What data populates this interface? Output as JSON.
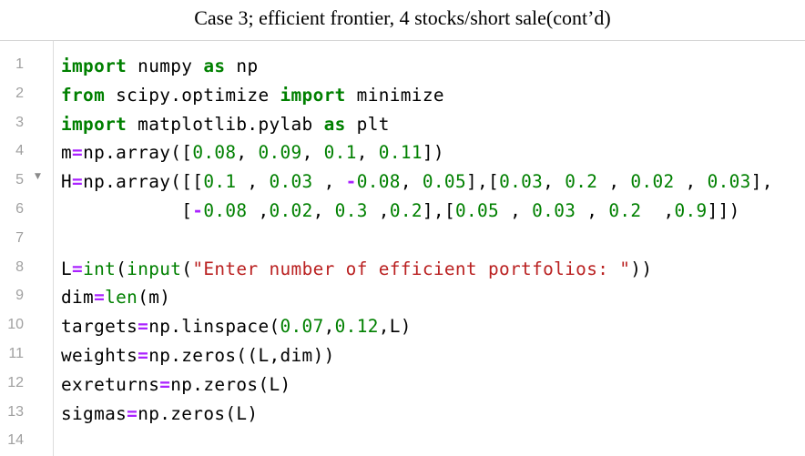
{
  "title": "Case 3; efficient frontier, 4 stocks/short sale(cont’d)",
  "editor": {
    "lines": [
      {
        "number": "1",
        "fold": "",
        "tokens": [
          {
            "t": "import",
            "c": "kw"
          },
          {
            "t": " numpy ",
            "c": "id"
          },
          {
            "t": "as",
            "c": "kw"
          },
          {
            "t": " np",
            "c": "id"
          }
        ]
      },
      {
        "number": "2",
        "fold": "",
        "tokens": [
          {
            "t": "from",
            "c": "kw"
          },
          {
            "t": " scipy.optimize ",
            "c": "id"
          },
          {
            "t": "import",
            "c": "kw"
          },
          {
            "t": " minimize",
            "c": "id"
          }
        ]
      },
      {
        "number": "3",
        "fold": "",
        "tokens": [
          {
            "t": "import",
            "c": "kw"
          },
          {
            "t": " matplotlib.pylab ",
            "c": "id"
          },
          {
            "t": "as",
            "c": "kw"
          },
          {
            "t": " plt",
            "c": "id"
          }
        ]
      },
      {
        "number": "4",
        "fold": "",
        "tokens": [
          {
            "t": "m",
            "c": "id"
          },
          {
            "t": "=",
            "c": "op"
          },
          {
            "t": "np.array([",
            "c": "id"
          },
          {
            "t": "0.08",
            "c": "num"
          },
          {
            "t": ", ",
            "c": "pu"
          },
          {
            "t": "0.09",
            "c": "num"
          },
          {
            "t": ", ",
            "c": "pu"
          },
          {
            "t": "0.1",
            "c": "num"
          },
          {
            "t": ", ",
            "c": "pu"
          },
          {
            "t": "0.11",
            "c": "num"
          },
          {
            "t": "])",
            "c": "pu"
          }
        ]
      },
      {
        "number": "5",
        "fold": "▼",
        "tokens": [
          {
            "t": "H",
            "c": "id"
          },
          {
            "t": "=",
            "c": "op"
          },
          {
            "t": "np.array([[",
            "c": "id"
          },
          {
            "t": "0.1",
            "c": "num"
          },
          {
            "t": " , ",
            "c": "pu"
          },
          {
            "t": "0.03",
            "c": "num"
          },
          {
            "t": " , ",
            "c": "pu"
          },
          {
            "t": "-",
            "c": "op"
          },
          {
            "t": "0.08",
            "c": "num"
          },
          {
            "t": ", ",
            "c": "pu"
          },
          {
            "t": "0.05",
            "c": "num"
          },
          {
            "t": "],[",
            "c": "pu"
          },
          {
            "t": "0.03",
            "c": "num"
          },
          {
            "t": ", ",
            "c": "pu"
          },
          {
            "t": "0.2",
            "c": "num"
          },
          {
            "t": " , ",
            "c": "pu"
          },
          {
            "t": "0.02",
            "c": "num"
          },
          {
            "t": " , ",
            "c": "pu"
          },
          {
            "t": "0.03",
            "c": "num"
          },
          {
            "t": "],",
            "c": "pu"
          }
        ]
      },
      {
        "number": "6",
        "fold": "",
        "tokens": [
          {
            "t": "           [",
            "c": "pu"
          },
          {
            "t": "-",
            "c": "op"
          },
          {
            "t": "0.08",
            "c": "num"
          },
          {
            "t": " ,",
            "c": "pu"
          },
          {
            "t": "0.02",
            "c": "num"
          },
          {
            "t": ", ",
            "c": "pu"
          },
          {
            "t": "0.3",
            "c": "num"
          },
          {
            "t": " ,",
            "c": "pu"
          },
          {
            "t": "0.2",
            "c": "num"
          },
          {
            "t": "],[",
            "c": "pu"
          },
          {
            "t": "0.05",
            "c": "num"
          },
          {
            "t": " , ",
            "c": "pu"
          },
          {
            "t": "0.03",
            "c": "num"
          },
          {
            "t": " , ",
            "c": "pu"
          },
          {
            "t": "0.2",
            "c": "num"
          },
          {
            "t": "  ,",
            "c": "pu"
          },
          {
            "t": "0.9",
            "c": "num"
          },
          {
            "t": "]])",
            "c": "pu"
          }
        ]
      },
      {
        "number": "7",
        "fold": "",
        "tokens": []
      },
      {
        "number": "8",
        "fold": "",
        "tokens": [
          {
            "t": "L",
            "c": "id"
          },
          {
            "t": "=",
            "c": "op"
          },
          {
            "t": "int",
            "c": "bi"
          },
          {
            "t": "(",
            "c": "pu"
          },
          {
            "t": "input",
            "c": "bi"
          },
          {
            "t": "(",
            "c": "pu"
          },
          {
            "t": "\"Enter number of efficient portfolios: \"",
            "c": "str"
          },
          {
            "t": "))",
            "c": "pu"
          }
        ]
      },
      {
        "number": "9",
        "fold": "",
        "tokens": [
          {
            "t": "dim",
            "c": "id"
          },
          {
            "t": "=",
            "c": "op"
          },
          {
            "t": "len",
            "c": "bi"
          },
          {
            "t": "(m)",
            "c": "pu"
          }
        ]
      },
      {
        "number": "10",
        "fold": "",
        "tokens": [
          {
            "t": "targets",
            "c": "id"
          },
          {
            "t": "=",
            "c": "op"
          },
          {
            "t": "np.linspace(",
            "c": "id"
          },
          {
            "t": "0.07",
            "c": "num"
          },
          {
            "t": ",",
            "c": "pu"
          },
          {
            "t": "0.12",
            "c": "num"
          },
          {
            "t": ",L)",
            "c": "pu"
          }
        ]
      },
      {
        "number": "11",
        "fold": "",
        "tokens": [
          {
            "t": "weights",
            "c": "id"
          },
          {
            "t": "=",
            "c": "op"
          },
          {
            "t": "np.zeros((L,dim))",
            "c": "id"
          }
        ]
      },
      {
        "number": "12",
        "fold": "",
        "tokens": [
          {
            "t": "exreturns",
            "c": "id"
          },
          {
            "t": "=",
            "c": "op"
          },
          {
            "t": "np.zeros(L)",
            "c": "id"
          }
        ]
      },
      {
        "number": "13",
        "fold": "",
        "tokens": [
          {
            "t": "sigmas",
            "c": "id"
          },
          {
            "t": "=",
            "c": "op"
          },
          {
            "t": "np.zeros(L)",
            "c": "id"
          }
        ]
      },
      {
        "number": "14",
        "fold": "",
        "tokens": []
      }
    ]
  }
}
